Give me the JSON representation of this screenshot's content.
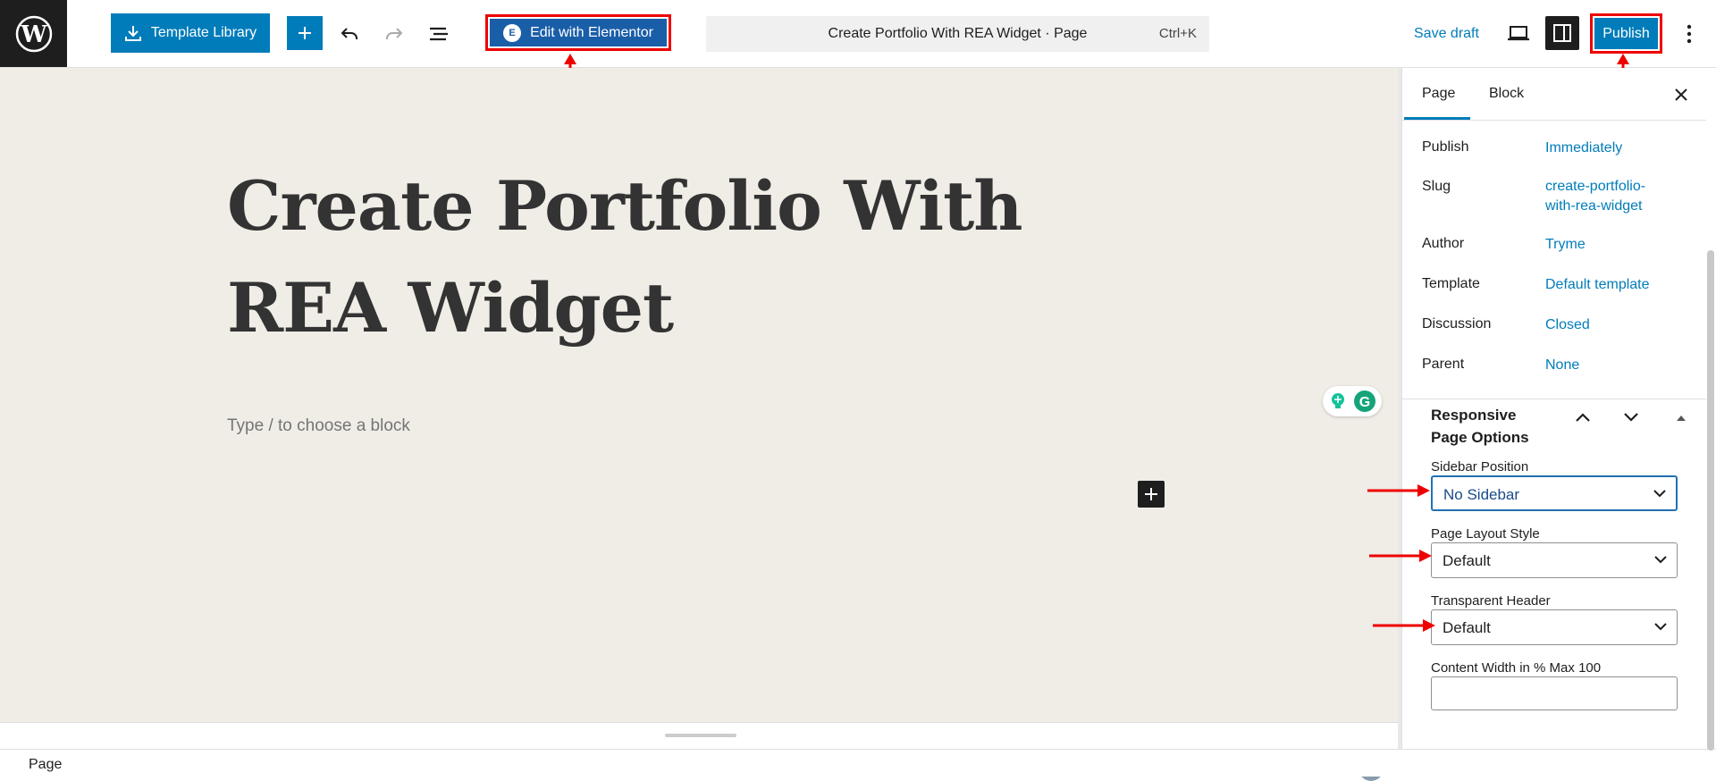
{
  "toolbar": {
    "template_library_label": "Template Library",
    "edit_elementor_label": "Edit with Elementor",
    "elementor_badge": "E",
    "doc_title": "Create Portfolio With REA Widget · Page",
    "doc_shortcut": "Ctrl+K",
    "save_draft_label": "Save draft",
    "publish_label": "Publish"
  },
  "editor": {
    "title": "Create Portfolio With REA Widget",
    "placeholder": "Type / to choose a block"
  },
  "sidebar": {
    "tabs": [
      {
        "label": "Page",
        "active": true
      },
      {
        "label": "Block",
        "active": false
      }
    ],
    "summary": [
      {
        "label": "Publish",
        "value": "Immediately"
      },
      {
        "label": "Slug",
        "value": "create-portfolio-with-rea-widget"
      },
      {
        "label": "Author",
        "value": "Tryme"
      },
      {
        "label": "Template",
        "value": "Default template"
      },
      {
        "label": "Discussion",
        "value": "Closed"
      },
      {
        "label": "Parent",
        "value": "None"
      }
    ],
    "panel": {
      "title": "Responsive Page Options",
      "fields": [
        {
          "label": "Sidebar Position",
          "value": "No Sidebar"
        },
        {
          "label": "Page Layout Style",
          "value": "Default"
        },
        {
          "label": "Transparent Header",
          "value": "Default"
        },
        {
          "label": "Content Width in % Max 100",
          "value": ""
        }
      ]
    }
  },
  "footer": {
    "breadcrumb": "Page"
  },
  "colors": {
    "accent": "#007cba",
    "highlight": "#e00000",
    "canvas": "#f0ede7",
    "elementor": "#1a5ea8"
  }
}
